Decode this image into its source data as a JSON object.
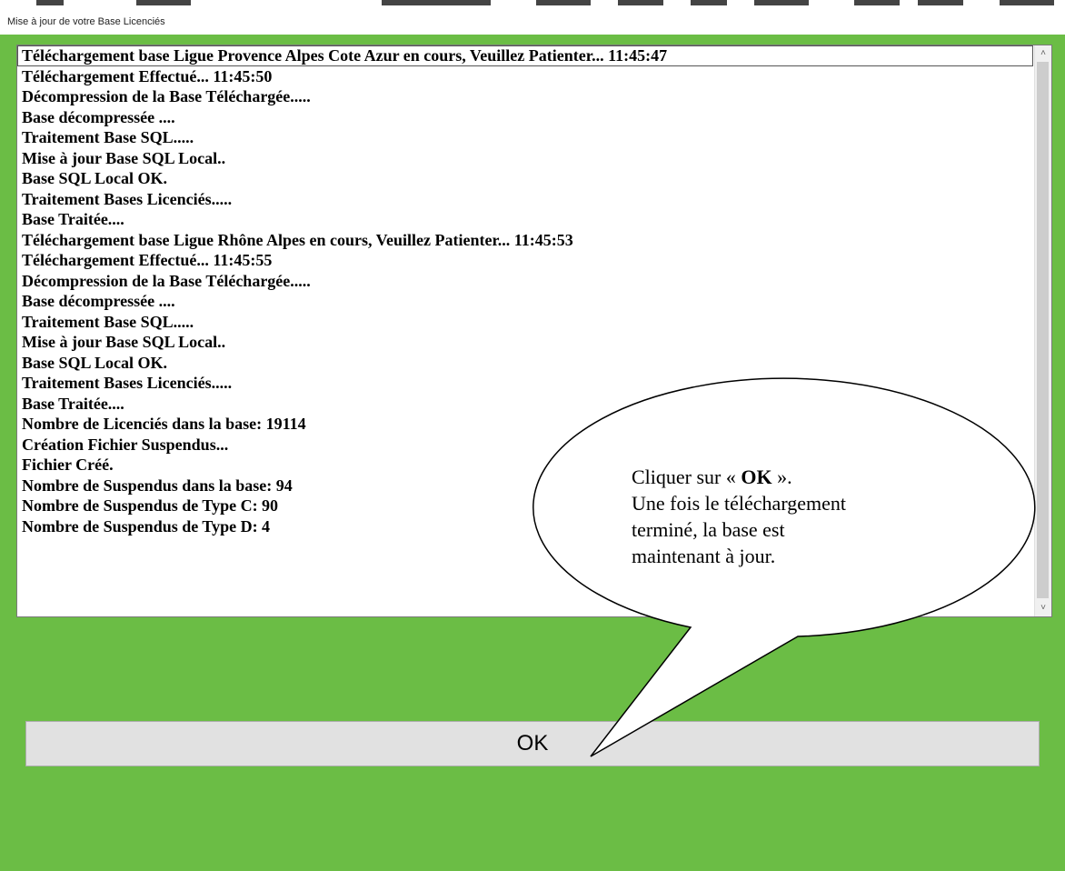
{
  "window": {
    "title": "Mise à jour de votre Base Licenciés"
  },
  "log": {
    "lines": [
      "Téléchargement base Ligue Provence Alpes Cote Azur en cours, Veuillez Patienter... 11:45:47",
      "Téléchargement Effectué... 11:45:50",
      "Décompression de la Base Téléchargée.....",
      "Base décompressée ....",
      "Traitement Base SQL.....",
      "Mise à jour Base SQL Local..",
      "Base SQL Local OK.",
      "Traitement Bases Licenciés.....",
      "Base Traitée....",
      "Téléchargement base Ligue Rhône Alpes en cours, Veuillez Patienter... 11:45:53",
      "Téléchargement Effectué... 11:45:55",
      "Décompression de la Base Téléchargée.....",
      "Base décompressée ....",
      "Traitement Base SQL.....",
      "Mise à jour Base SQL Local..",
      "Base SQL Local OK.",
      "Traitement Bases Licenciés.....",
      "Base Traitée....",
      "Nombre de Licenciés dans la base: 19114",
      "Création Fichier Suspendus...",
      "Fichier Créé.",
      "Nombre de Suspendus dans la base: 94",
      "Nombre de Suspendus de Type C: 90",
      "Nombre de Suspendus de Type D: 4"
    ],
    "scroll_up_glyph": "˄",
    "scroll_down_glyph": "˅"
  },
  "ok_button": {
    "label": "OK"
  },
  "callout": {
    "line1_prefix": "Cliquer sur « ",
    "line1_bold": "OK",
    "line1_suffix": " ».",
    "line2": "Une fois le téléchargement",
    "line3": "terminé, la base est",
    "line4": "maintenant à jour."
  },
  "colors": {
    "background": "#6bbd45",
    "list_background": "#ffffff",
    "button": "#e1e1e1"
  }
}
